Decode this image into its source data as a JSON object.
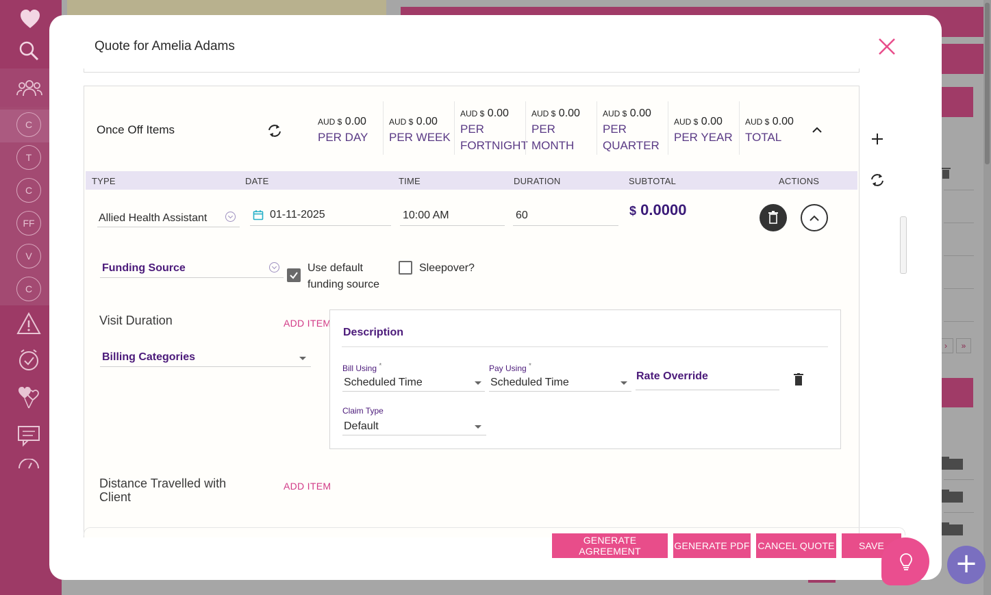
{
  "modal": {
    "title": "Quote for Amelia Adams"
  },
  "sidebar": {
    "client_initials": [
      "C",
      "T",
      "C",
      "FF",
      "V",
      "C"
    ]
  },
  "once_off": {
    "title": "Once Off Items",
    "stats": [
      {
        "currency": "AUD $",
        "amount": "0.00",
        "label_lines": [
          "PER DAY"
        ]
      },
      {
        "currency": "AUD $",
        "amount": "0.00",
        "label_lines": [
          "PER WEEK"
        ]
      },
      {
        "currency": "AUD $",
        "amount": "0.00",
        "label_lines": [
          "PER",
          "FORTNIGHT"
        ]
      },
      {
        "currency": "AUD $",
        "amount": "0.00",
        "label_lines": [
          "PER",
          "MONTH"
        ]
      },
      {
        "currency": "AUD $",
        "amount": "0.00",
        "label_lines": [
          "PER",
          "QUARTER"
        ]
      },
      {
        "currency": "AUD $",
        "amount": "0.00",
        "label_lines": [
          "PER YEAR"
        ]
      },
      {
        "currency": "AUD $",
        "amount": "0.00",
        "label_lines": [
          "TOTAL"
        ]
      }
    ]
  },
  "table": {
    "headers": [
      "TYPE",
      "DATE",
      "TIME",
      "DURATION",
      "SUBTOTAL",
      "ACTIONS"
    ],
    "row": {
      "type": "Allied Health Assistant",
      "date": "01-11-2025",
      "time": "10:00 AM",
      "duration": "60",
      "subtotal_currency": "$",
      "subtotal": "0.0000"
    }
  },
  "funding": {
    "label": "Funding Source",
    "use_default_label_1": "Use default",
    "use_default_label_2": "funding source",
    "use_default_checked": true,
    "sleepover_label": "Sleepover?",
    "sleepover_checked": false
  },
  "visit_duration": {
    "label": "Visit Duration",
    "add_item": "ADD ITEM",
    "billing_categories": "Billing Categories"
  },
  "description": {
    "title": "Description",
    "bill_using_label": "Bill Using",
    "bill_using_value": "Scheduled Time",
    "pay_using_label": "Pay Using",
    "pay_using_value": "Scheduled Time",
    "required_mark": "*",
    "rate_override": "Rate Override",
    "claim_type_label": "Claim Type",
    "claim_type_value": "Default"
  },
  "distance": {
    "label_1": "Distance Travelled with",
    "label_2": "Client",
    "add_item": "ADD ITEM"
  },
  "footer": {
    "generate_agreement": "GENERATE AGREEMENT",
    "generate_pdf": "GENERATE PDF",
    "cancel_quote": "CANCEL QUOTE",
    "save": "SAVE"
  },
  "background": {
    "pagination": [
      "›",
      "»"
    ]
  },
  "colors": {
    "primary_pink": "#e84d8a",
    "sidebar": "#9d3a66",
    "purple_text": "#4b1a7a",
    "header_band": "#e8e3f3"
  }
}
